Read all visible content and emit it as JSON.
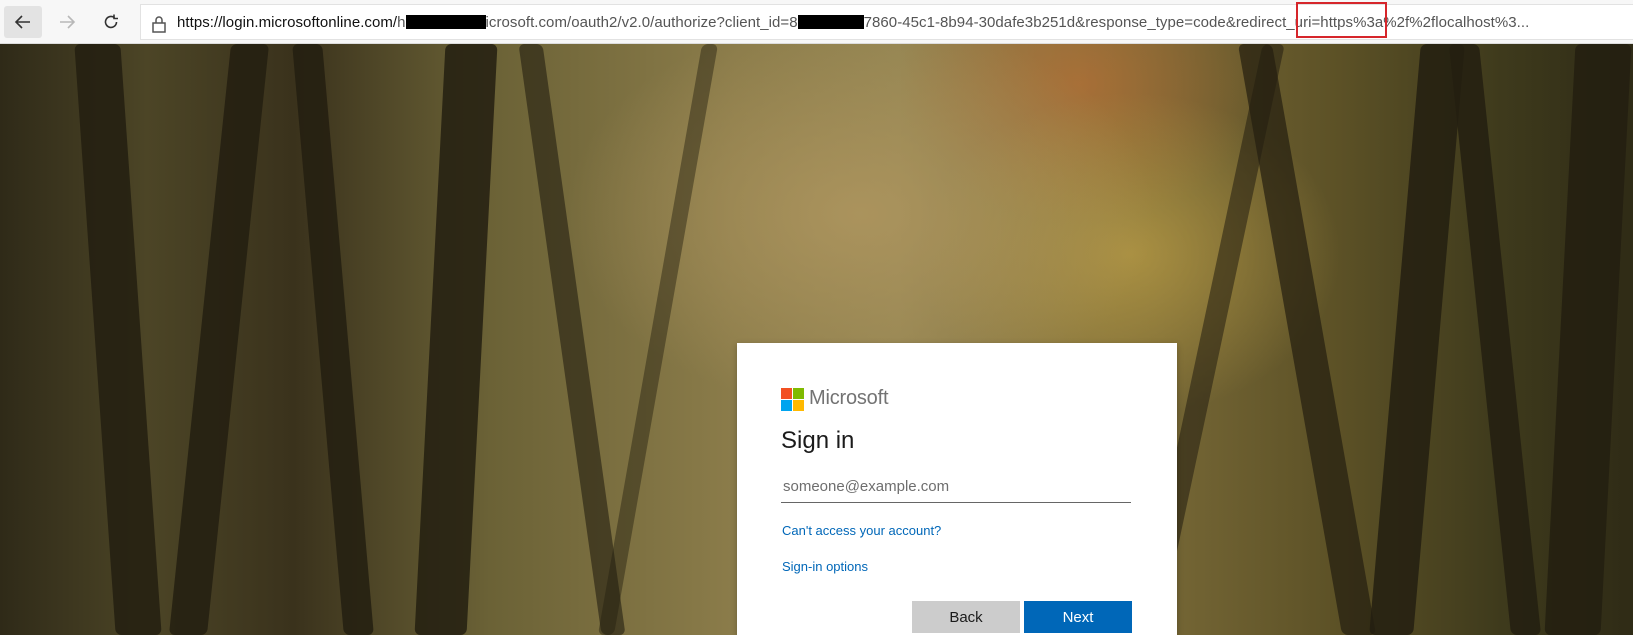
{
  "browser": {
    "url_host": "https://login.microsoftonline.com/",
    "url_segment_1": "h",
    "url_segment_2": "icrosoft.com/oauth2/v2.0/authorize?client_id=8",
    "url_segment_3": "7860-45c1-8b94-30dafe3b251d&response_type=code",
    "url_highlighted": "&redirect_uri",
    "url_tail": "=https%3a%2f%2flocalhost%3...",
    "highlight_color": "#d6262b"
  },
  "signin": {
    "brand": "Microsoft",
    "title": "Sign in",
    "email_placeholder": "someone@example.com",
    "email_value": "",
    "cant_access_link": "Can't access your account?",
    "options_link": "Sign-in options",
    "back_label": "Back",
    "next_label": "Next"
  },
  "colors": {
    "accent": "#0067b8",
    "logo_red": "#f25022",
    "logo_green": "#7fba00",
    "logo_blue": "#00a4ef",
    "logo_yellow": "#ffb900"
  }
}
